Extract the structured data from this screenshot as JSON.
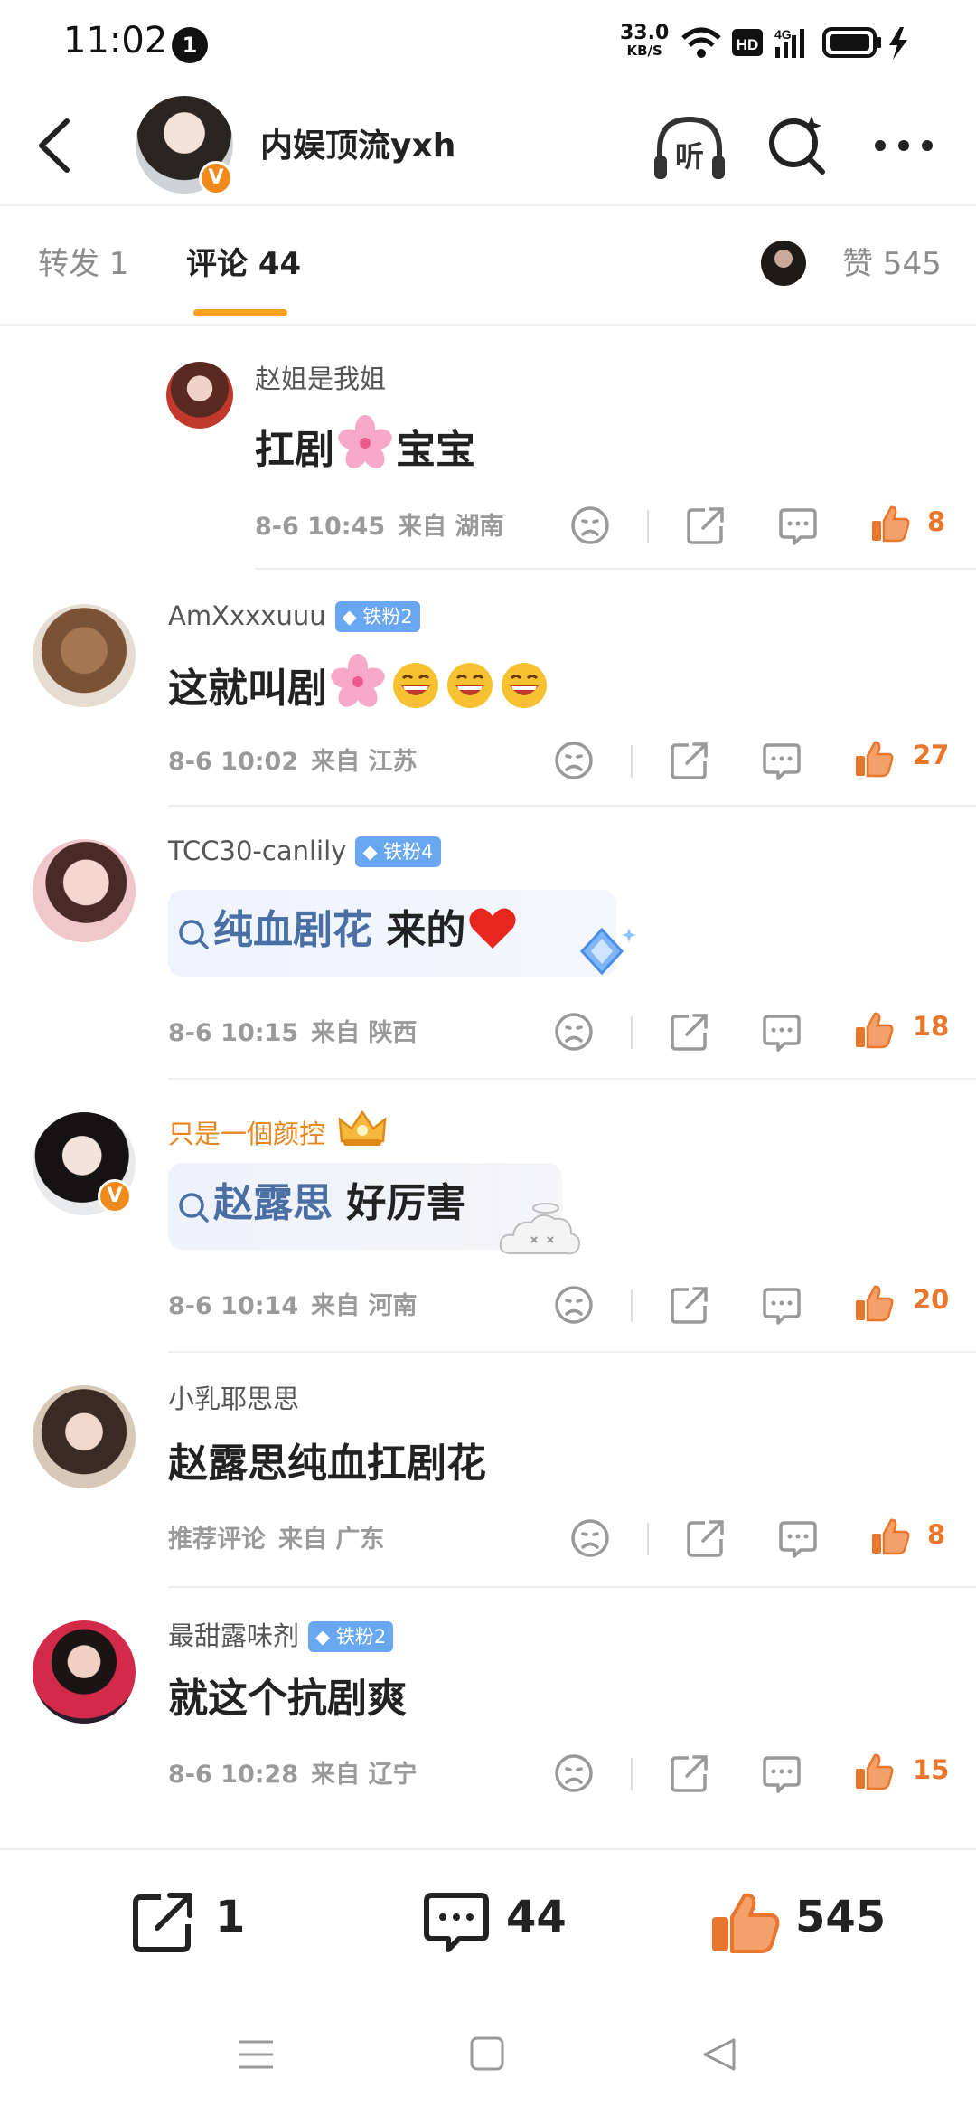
{
  "status_bar": {
    "time": "11:02",
    "notification_count": "1",
    "net_speed_value": "33.0",
    "net_speed_unit": "KB/S",
    "hd_label": "HD",
    "network": "4G"
  },
  "header": {
    "username": "内娱顶流yxh",
    "verified_badge": "V",
    "listen_label": "听"
  },
  "tabs": {
    "repost": "转发 1",
    "comment": "评论 44",
    "likes": "赞 545"
  },
  "comments": [
    {
      "user": "赵姐是我姐",
      "text_before": "扛剧",
      "text_after": "宝宝",
      "date": "8-6 10:45",
      "location": "来自 湖南",
      "likes": "8"
    },
    {
      "user": "AmXxxxuuu",
      "badge": "铁粉2",
      "text": "这就叫剧",
      "date": "8-6 10:02",
      "location": "来自 江苏",
      "likes": "27"
    },
    {
      "user": "TCC30-canlily",
      "badge": "铁粉4",
      "topic": "纯血剧花",
      "text": " 来的",
      "date": "8-6 10:15",
      "location": "来自 陕西",
      "likes": "18"
    },
    {
      "user": "只是一個颜控",
      "verified_badge": "V",
      "topic": "赵露思",
      "text": " 好厉害",
      "date": "8-6 10:14",
      "location": "来自 河南",
      "likes": "20"
    },
    {
      "user": "小乳耶思思",
      "text": "赵露思纯血扛剧花",
      "date": "推荐评论",
      "location": "来自 广东",
      "likes": "8"
    },
    {
      "user": "最甜露味剂",
      "badge": "铁粉2",
      "text": "就这个抗剧爽",
      "date": "8-6 10:28",
      "location": "来自 辽宁",
      "likes": "15"
    }
  ],
  "bottom_bar": {
    "repost_count": "1",
    "comment_count": "44",
    "like_count": "545"
  },
  "colors": {
    "accent_orange": "#f6a21c",
    "like_orange": "#e8762d",
    "fan_badge_blue": "#6aa7f2",
    "topic_blue": "#4a6fa5"
  },
  "icons": [
    "back-icon",
    "headphones-icon",
    "search-icon",
    "more-icon",
    "sad-face-icon",
    "share-icon",
    "reply-icon",
    "thumbs-up-icon",
    "sakura-emoji",
    "laugh-emoji",
    "heart-emoji",
    "diamond-icon",
    "crown-icon"
  ]
}
